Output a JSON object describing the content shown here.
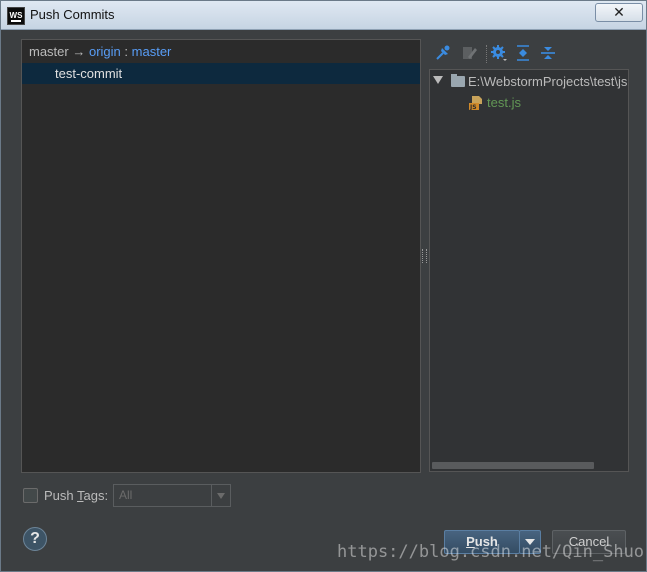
{
  "window": {
    "title": "Push Commits",
    "app_icon_text": "WS",
    "close_symbol": "✕"
  },
  "left_panel": {
    "local_branch": "master",
    "arrow": "→",
    "remote": "origin",
    "separator": ":",
    "remote_branch": "master",
    "commits": [
      "test-commit"
    ]
  },
  "toolbar": {
    "icons": [
      "pin-icon",
      "edit-source-icon",
      "settings-gear-icon",
      "expand-all-icon",
      "collapse-all-icon"
    ]
  },
  "tree": {
    "root_path": "E:\\WebstormProjects\\test\\js",
    "files": [
      "test.js"
    ]
  },
  "footer": {
    "push_tags_prefix": "Push ",
    "push_tags_mnemonic": "T",
    "push_tags_suffix": "ags:",
    "tags_value": "All",
    "help_symbol": "?",
    "push_prefix": "",
    "push_mnemonic": "P",
    "push_suffix": "ush",
    "cancel_label": "Cancel"
  },
  "watermark": "https://blog.csdn.net/Qin_Shuo",
  "colors": {
    "background": "#3c3f41",
    "link": "#589df6",
    "selection": "#0d293e",
    "file_added": "#629755",
    "primary_button": "#3e5871"
  }
}
